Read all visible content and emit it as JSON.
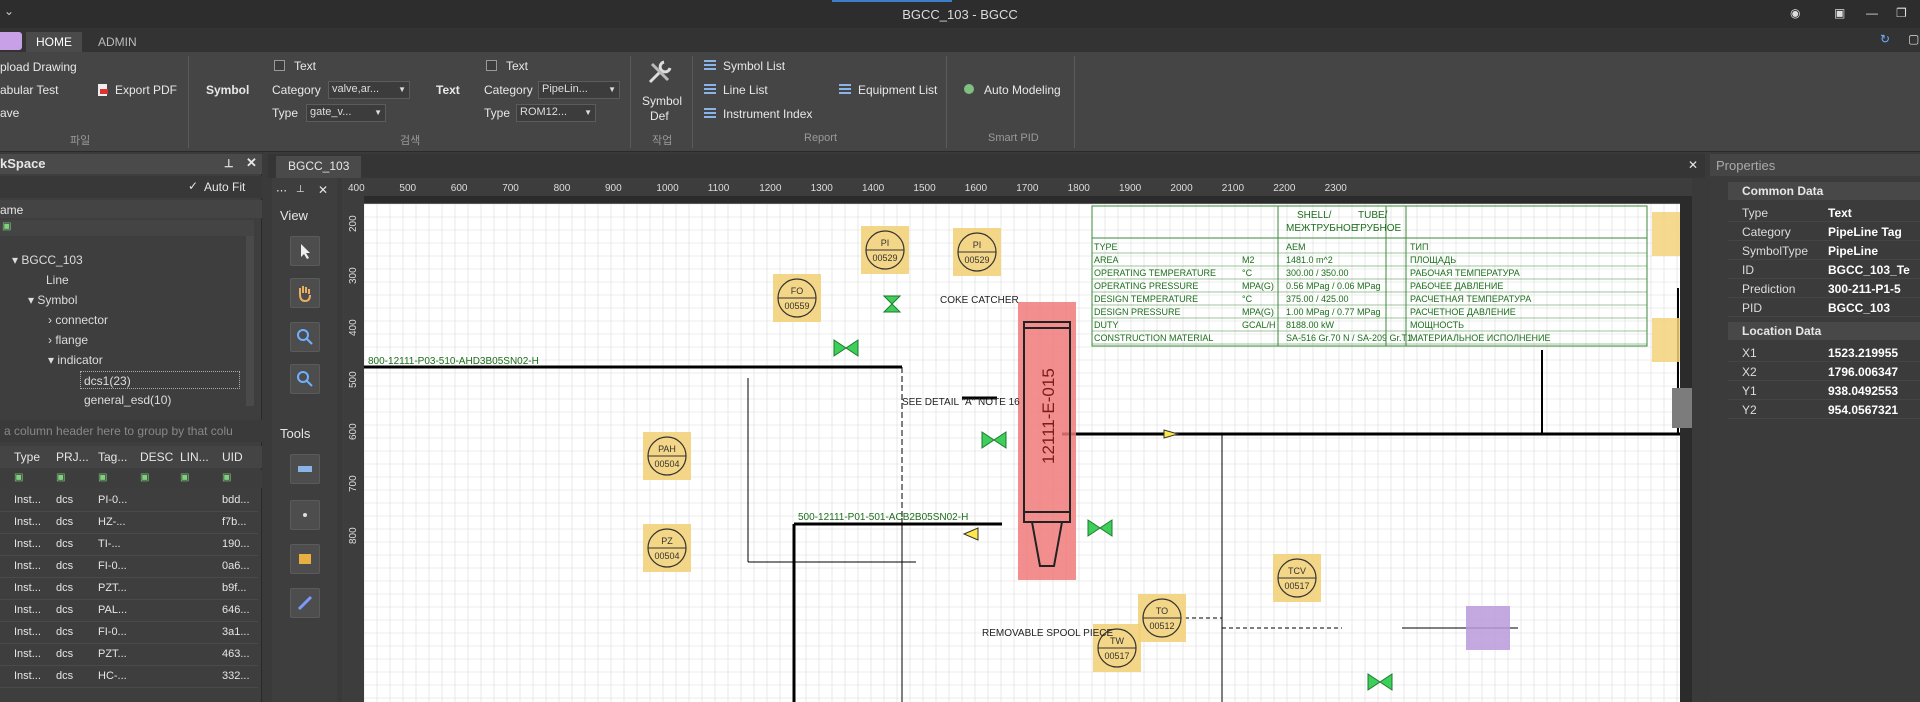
{
  "window": {
    "title": "BGCC_103 - BGCC"
  },
  "ribbon_tabs": [
    "HOME",
    "ADMIN"
  ],
  "ribbon": {
    "file_group": {
      "upload": "pload Drawing",
      "tabular": "abular Test",
      "save": "ave",
      "export": "Export PDF",
      "group_label": "파일"
    },
    "symbol_search": {
      "label": "Symbol",
      "text_checkbox": "Text",
      "category_label": "Category",
      "category_value": "valve,ar...",
      "type_label": "Type",
      "type_value": "gate_v..."
    },
    "text_search": {
      "label": "Text",
      "text_checkbox": "Text",
      "category_label": "Category",
      "category_value": "PipeLin...",
      "type_label": "Type",
      "type_value": "ROM12..."
    },
    "search_group_label": "검색",
    "symbol_def": [
      "Symbol",
      "Def"
    ],
    "work_group_label": "작업",
    "report": {
      "symbol_list": "Symbol List",
      "line_list": "Line List",
      "equipment_list": "Equipment List",
      "instrument_index": "Instrument Index",
      "group_label": "Report"
    },
    "smart_pid": {
      "auto_modeling": "Auto Modeling",
      "group_label": "Smart PID"
    }
  },
  "left_panel": {
    "title": "kSpace",
    "auto_fit": "Auto Fit",
    "name_header": "ame",
    "tree": [
      {
        "label": "BGCC_103",
        "level": 0,
        "expanded": true
      },
      {
        "label": "Line",
        "level": 1
      },
      {
        "label": "Symbol",
        "level": 1,
        "expanded": true
      },
      {
        "label": "connector",
        "level": 2
      },
      {
        "label": "flange",
        "level": 2
      },
      {
        "label": "indicator",
        "level": 2,
        "expanded": true
      },
      {
        "label": "dcs1(23)",
        "level": 3,
        "selected": true
      },
      {
        "label": "general_esd(10)",
        "level": 3
      }
    ],
    "group_hint": "a column header here to group by that colu",
    "columns": [
      "Type",
      "PRJ...",
      "Tag...",
      "DESC",
      "LIN...",
      "UID"
    ],
    "rows": [
      [
        "Inst...",
        "dcs",
        "PI-0...",
        "",
        "",
        "bdd..."
      ],
      [
        "Inst...",
        "dcs",
        "HZ-...",
        "",
        "",
        "f7b..."
      ],
      [
        "Inst...",
        "dcs",
        "TI-...",
        "",
        "",
        "190..."
      ],
      [
        "Inst...",
        "dcs",
        "FI-0...",
        "",
        "",
        "0a6..."
      ],
      [
        "Inst...",
        "dcs",
        "PZT...",
        "",
        "",
        "b9f..."
      ],
      [
        "Inst...",
        "dcs",
        "PAL...",
        "",
        "",
        "646..."
      ],
      [
        "Inst...",
        "dcs",
        "FI-0...",
        "",
        "",
        "3a1..."
      ],
      [
        "Inst...",
        "dcs",
        "PZT...",
        "",
        "",
        "463..."
      ],
      [
        "Inst...",
        "dcs",
        "HC-...",
        "",
        "",
        "332..."
      ]
    ]
  },
  "tools": {
    "view_label": "View",
    "tools_label": "Tools"
  },
  "document": {
    "tab": "BGCC_103",
    "ruler_x": [
      "400",
      "500",
      "600",
      "700",
      "800",
      "900",
      "1000",
      "1100",
      "1200",
      "1300",
      "1400",
      "1500",
      "1600",
      "1700",
      "1800",
      "1900",
      "2000",
      "2100",
      "2200",
      "2300"
    ],
    "ruler_y": [
      "200",
      "300",
      "400",
      "500",
      "600",
      "700",
      "800"
    ],
    "drawing": {
      "equipment_tag": "12111-E-015",
      "datasheet_header": [
        "SHELL/",
        "TUBE/",
        "МЕЖТРУБНОЕ",
        "ТРУБНОЕ"
      ],
      "datasheet_rows": [
        [
          "TYPE",
          "",
          "AEM",
          "ТИП"
        ],
        [
          "AREA",
          "M2",
          "1481.0 m^2",
          "ПЛОЩАДЬ"
        ],
        [
          "OPERATING TEMPERATURE",
          "°C",
          "300.00 / 350.00",
          "РАБОЧАЯ ТЕМПЕРАТУРА"
        ],
        [
          "OPERATING PRESSURE",
          "MPA(G)",
          "0.56 MPag / 0.06 MPag",
          "РАБОЧЕЕ ДАВЛЕНИЕ"
        ],
        [
          "DESIGN TEMPERATURE",
          "°C",
          "375.00 / 425.00",
          "РАСЧЕТНАЯ ТЕМПЕРАТУРА"
        ],
        [
          "DESIGN PRESSURE",
          "MPA(G)",
          "1.00 MPag / 0.77 MPag",
          "РАСЧЕТНОЕ ДАВЛЕНИЕ"
        ],
        [
          "DUTY",
          "GCAL/H",
          "8188.00 kW",
          "МОЩНОСТЬ"
        ],
        [
          "CONSTRUCTION MATERIAL",
          "",
          "SA-516 Gr.70 N / SA-209 Gr.T1",
          "МАТЕРИАЛЬНОЕ ИСПОЛНЕНИЕ"
        ]
      ],
      "line_labels": [
        "800-12111-P03-510-AHD3B05SN02-H",
        "500-12111-P01-501-ACB2B05SN02-H"
      ],
      "instruments": [
        "PI 00529",
        "FO 00559",
        "PI 00529",
        "PAH 00504",
        "PZ 00504",
        "TCV 00517",
        "TW 00517",
        "TO 00512"
      ],
      "notes": [
        "COKE CATCHER",
        "SEE DETAIL \"A\" NOTE 16",
        "REMOVABLE SPOOL PIECE"
      ]
    }
  },
  "properties": {
    "title": "Properties",
    "common_label": "Common Data",
    "common": [
      {
        "k": "Type",
        "v": "Text"
      },
      {
        "k": "Category",
        "v": "PipeLine Tag"
      },
      {
        "k": "SymbolType",
        "v": "PipeLine"
      },
      {
        "k": "ID",
        "v": "BGCC_103_Te"
      },
      {
        "k": "Prediction",
        "v": "300-211-P1-5"
      },
      {
        "k": "PID",
        "v": "BGCC_103"
      }
    ],
    "location_label": "Location Data",
    "location": [
      {
        "k": "X1",
        "v": "1523.219955"
      },
      {
        "k": "X2",
        "v": "1796.006347"
      },
      {
        "k": "Y1",
        "v": "938.0492553"
      },
      {
        "k": "Y2",
        "v": "954.0567321"
      }
    ]
  },
  "colors": {
    "accent": "#3b7fc9",
    "highlight_yellow": "#f2d27a",
    "highlight_red": "#f07a7a",
    "highlight_purple": "#b99adb",
    "line_green": "#1c8a2e"
  }
}
